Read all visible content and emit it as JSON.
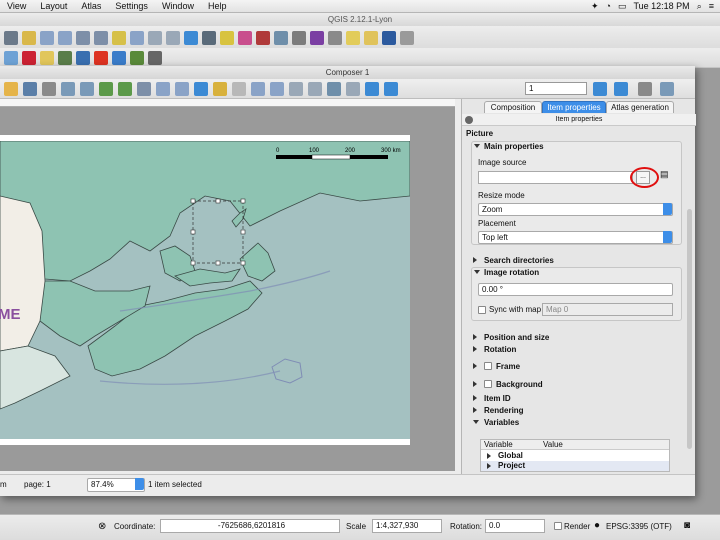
{
  "menubar": {
    "items": [
      "View",
      "Layout",
      "Atlas",
      "Settings",
      "Window",
      "Help"
    ],
    "clock": "Tue 12:18 PM"
  },
  "app_title": "QGIS 2.12.1-Lyon",
  "composer": {
    "title": "Composer 1",
    "atlas_page_value": "1",
    "tabs": [
      {
        "label": "Composition",
        "active": false
      },
      {
        "label": "Item properties",
        "active": true
      },
      {
        "label": "Atlas generation",
        "active": false
      }
    ],
    "panel_header": "Item properties",
    "section_title": "Picture",
    "main_properties": "Main properties",
    "image_source_label": "Image source",
    "image_source_value": "",
    "browse_button": "...",
    "resize_mode_label": "Resize mode",
    "resize_mode_value": "Zoom",
    "placement_label": "Placement",
    "placement_value": "Top left",
    "search_directories": "Search directories",
    "image_rotation": "Image rotation",
    "rotation_value": "0.00 °",
    "sync_with_map": "Sync with map",
    "sync_map_value": "Map 0",
    "groups": [
      "Position and size",
      "Rotation"
    ],
    "check_groups": [
      "Frame",
      "Background"
    ],
    "groups2": [
      "Item ID",
      "Rendering"
    ],
    "variables": "Variables",
    "var_headers": [
      "Variable",
      "Value"
    ],
    "var_rows": [
      "Global",
      "Project"
    ],
    "scale_bar": {
      "ticks": [
        "0",
        "100",
        "200",
        "300 km"
      ]
    },
    "map_label_fragment": "ME",
    "status": {
      "cursor_prefix": "m",
      "page": "page: 1",
      "zoom": "87.4%",
      "selected": "1 item selected"
    }
  },
  "main_status": {
    "coordinate_label": "Coordinate:",
    "coordinate_value": "-7625686,6201816",
    "scale_label": "Scale",
    "scale_value": "1:4,327,930",
    "rotation_label": "Rotation:",
    "rotation_value": "0.0",
    "render_label": "Render",
    "crs": "EPSG:3395 (OTF)"
  },
  "colors": {
    "water": "#a4c1c1",
    "land": "#8ec3b2",
    "coast": "#3a4a46",
    "highlight_circle": "#e01010",
    "accent": "#3d8ee8"
  }
}
